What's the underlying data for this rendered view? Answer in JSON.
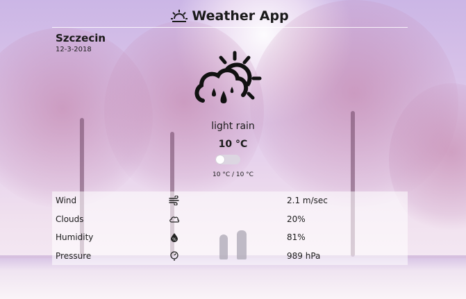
{
  "app": {
    "title": "Weather App",
    "icon": "sunrise-icon"
  },
  "location": {
    "city": "Szczecin",
    "date": "12-3-2018"
  },
  "current": {
    "icon": "light-rain-sun-icon",
    "condition": "light rain",
    "temperature": "10 °C",
    "unit_toggle_on": false,
    "min_max": "10 °C / 10 °C"
  },
  "details": [
    {
      "label": "Wind",
      "icon": "wind-icon",
      "value": "2.1 m/sec"
    },
    {
      "label": "Clouds",
      "icon": "cloud-icon",
      "value": "20%"
    },
    {
      "label": "Humidity",
      "icon": "humidity-drop-icon",
      "value": "81%"
    },
    {
      "label": "Pressure",
      "icon": "pressure-gauge-icon",
      "value": "989 hPa"
    }
  ]
}
